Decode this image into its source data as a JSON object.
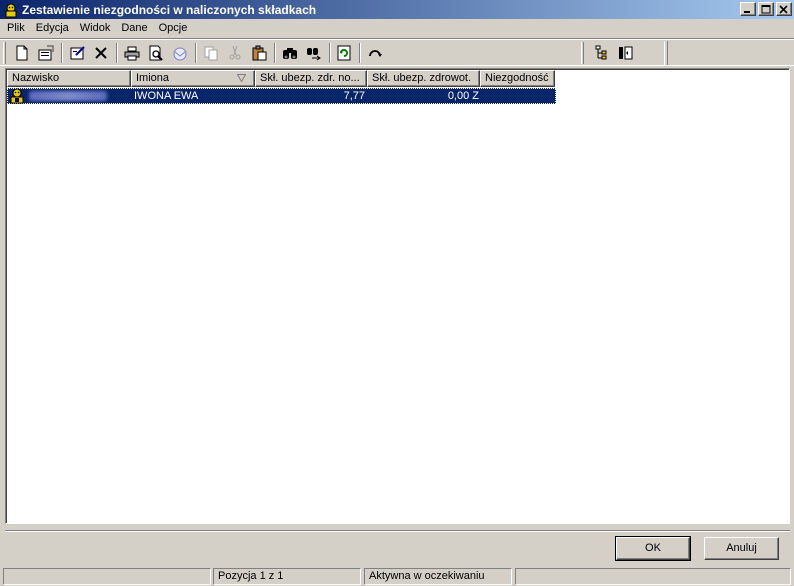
{
  "window": {
    "title": "Zestawienie niezgodności w naliczonych składkach"
  },
  "menu": {
    "items": [
      "Plik",
      "Edycja",
      "Widok",
      "Dane",
      "Opcje"
    ]
  },
  "toolbar": {
    "icons": [
      "new-icon",
      "properties-icon",
      "edit-icon",
      "delete-icon",
      "print-icon",
      "print-preview-icon",
      "email-icon",
      "copy-icon",
      "cut-icon",
      "paste-icon",
      "find-icon",
      "find-next-icon",
      "refresh-icon",
      "undo-icon",
      "tree-icon",
      "columns-icon"
    ]
  },
  "table": {
    "columns": [
      "Nazwisko",
      "Imiona",
      "Skł. ubezp. zdr. no...",
      "Skł. ubezp. zdrowot.",
      "Niezgodność"
    ],
    "sorted_column": "Imiona",
    "rows": [
      {
        "nazwisko": "",
        "imiona": "IWONA EWA",
        "skl_no": "7,77",
        "skl_zdrowot": "0,00 Z",
        "niezgodnosc": ""
      }
    ]
  },
  "buttons": {
    "ok": "OK",
    "cancel": "Anuluj"
  },
  "status": {
    "panel1": "",
    "panel2": "Pozycja 1 z 1",
    "panel3": "Aktywna w oczekiwaniu",
    "panel4": ""
  },
  "colors": {
    "selection": "#0a246a",
    "face": "#d4d0c8"
  }
}
